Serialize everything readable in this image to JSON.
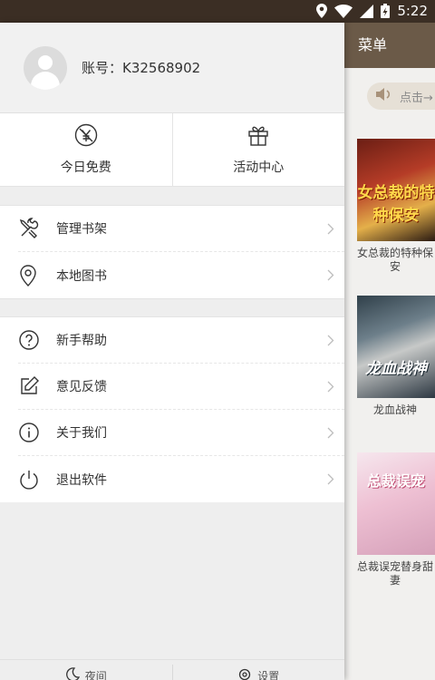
{
  "status_bar": {
    "time": "5:22",
    "icons": [
      "location-icon",
      "wifi-icon",
      "signal-icon",
      "battery-icon"
    ]
  },
  "background_app": {
    "header_title": "菜单",
    "notice_text": "点击→",
    "books": [
      {
        "title": "女总裁的特种保安",
        "cover_text": "女总裁的特种保安"
      },
      {
        "title": "龙血战神",
        "cover_text": "龙血战神"
      },
      {
        "title": "总裁误宠替身甜妻",
        "cover_text": "总裁误宠"
      }
    ]
  },
  "drawer": {
    "account": {
      "label": "账号：K32568902"
    },
    "quick_actions": [
      {
        "label": "今日免费",
        "icon": "yuan-icon"
      },
      {
        "label": "活动中心",
        "icon": "gift-icon"
      }
    ],
    "menu_group_1": [
      {
        "label": "管理书架",
        "icon": "tools-icon"
      },
      {
        "label": "本地图书",
        "icon": "location-pin-icon"
      }
    ],
    "menu_group_2": [
      {
        "label": "新手帮助",
        "icon": "question-icon"
      },
      {
        "label": "意见反馈",
        "icon": "edit-icon"
      },
      {
        "label": "关于我们",
        "icon": "info-icon"
      },
      {
        "label": "退出软件",
        "icon": "power-icon"
      }
    ],
    "bottom_bar": [
      {
        "label": "夜间",
        "icon": "moon-icon"
      },
      {
        "label": "设置",
        "icon": "settings-icon"
      }
    ]
  },
  "colors": {
    "status_bar": "#3b2e24",
    "header": "#6b5a48",
    "drawer_bg": "#eeeeee"
  }
}
